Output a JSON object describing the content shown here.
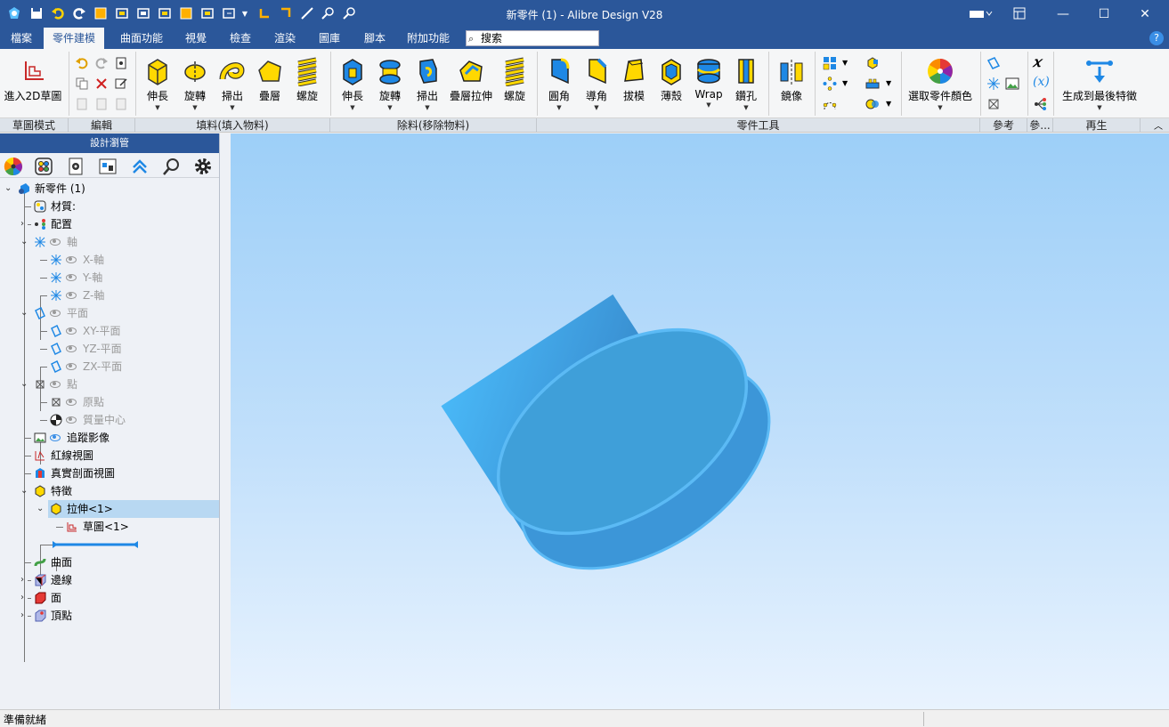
{
  "window": {
    "title": "新零件 (1) - Alibre Design V28"
  },
  "menu": {
    "tabs": [
      "檔案",
      "零件建模",
      "曲面功能",
      "視覺",
      "檢查",
      "渲染",
      "圖庫",
      "腳本",
      "附加功能"
    ],
    "active_tab": "零件建模",
    "search_placeholder": "搜索"
  },
  "ribbon": {
    "sketch": {
      "enter_2d": "進入2D草圖"
    },
    "fill": {
      "extrude": "伸長",
      "revolve": "旋轉",
      "sweep": "掃出",
      "loft": "疊層",
      "helix": "螺旋"
    },
    "cut": {
      "extrude": "伸長",
      "revolve": "旋轉",
      "sweep": "掃出",
      "loft_extrude": "疊層拉伸",
      "helix": "螺旋"
    },
    "tools": {
      "fillet": "圓角",
      "chamfer": "導角",
      "draft": "拔模",
      "shell": "薄殼",
      "wrap": "Wrap",
      "hole": "鑽孔",
      "mirror": "鏡像",
      "color": "選取零件顏色"
    },
    "regen": {
      "regen_to_last": "生成到最後特徵"
    },
    "groups": [
      "草圖模式",
      "編輯",
      "填料(填入物料)",
      "除料(移除物料)",
      "零件工具",
      "參考",
      "參...",
      "再生"
    ]
  },
  "panel": {
    "title": "設計瀏管",
    "tree": {
      "root": "新零件 (1)",
      "material": "材質:",
      "config": "配置",
      "axes": "軸",
      "x_axis": "X-軸",
      "y_axis": "Y-軸",
      "z_axis": "Z-軸",
      "planes": "平面",
      "xy_plane": "XY-平面",
      "yz_plane": "YZ-平面",
      "zx_plane": "ZX-平面",
      "points": "點",
      "origin": "原點",
      "center_mass": "質量中心",
      "trace_image": "追蹤影像",
      "redline": "紅線視圖",
      "section_view": "真實剖面視圖",
      "features": "特徵",
      "extrude1": "拉伸<1>",
      "sketch1": "草圖<1>",
      "surfaces": "曲面",
      "edges": "邊線",
      "faces": "面",
      "vertices": "頂點"
    }
  },
  "status": {
    "text": "準備就緒"
  },
  "colors": {
    "titlebar": "#2b579a",
    "accent": "#3a8ee6",
    "part": "#4aa3d8",
    "edge": "#5bbaf5"
  }
}
